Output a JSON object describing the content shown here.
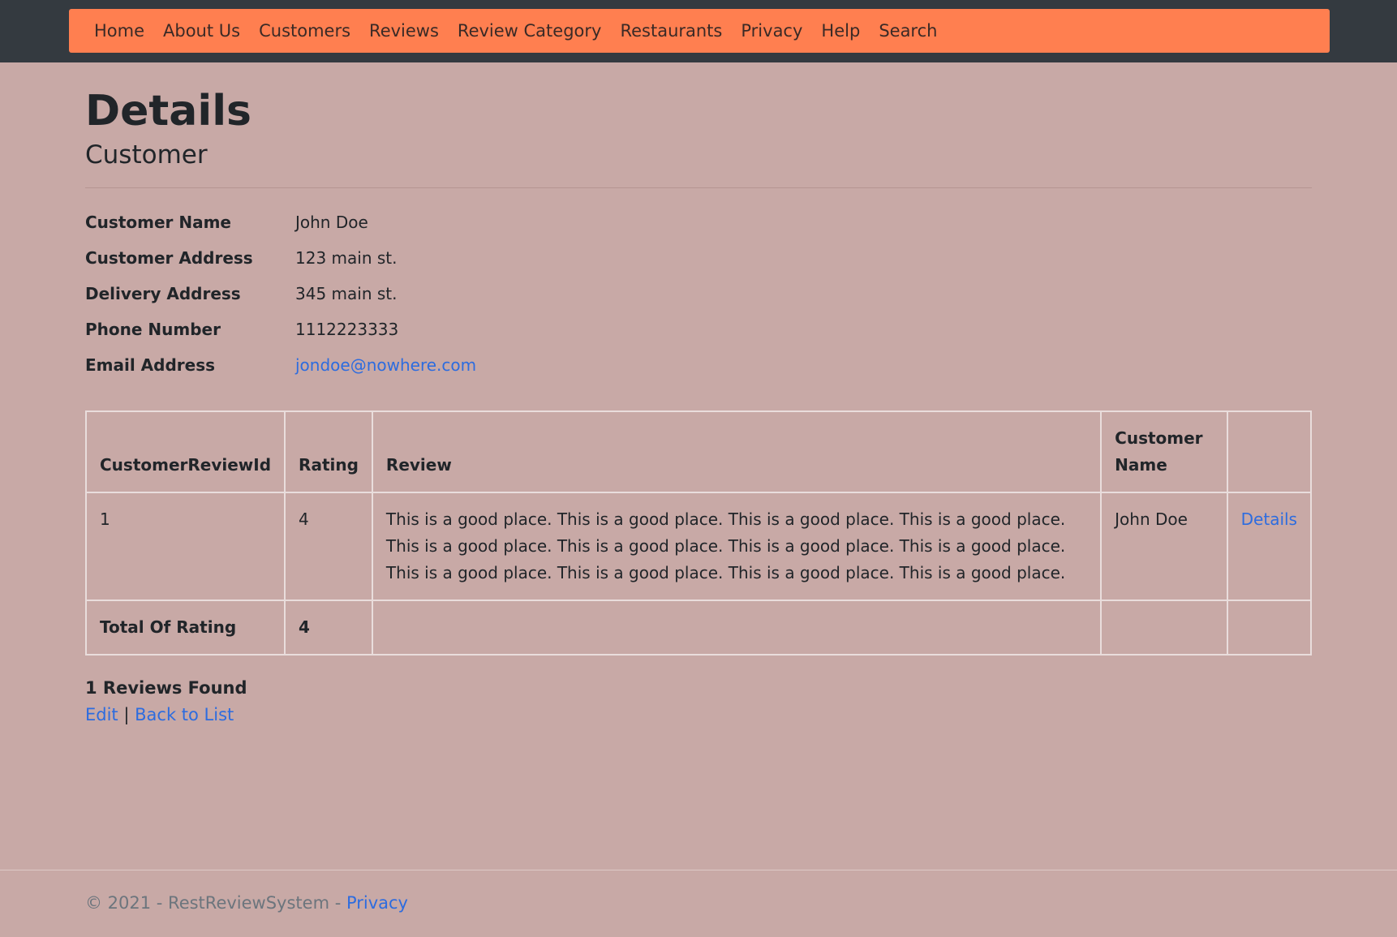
{
  "nav": {
    "items": [
      "Home",
      "About Us",
      "Customers",
      "Reviews",
      "Review Category",
      "Restaurants",
      "Privacy",
      "Help",
      "Search"
    ]
  },
  "page": {
    "title": "Details",
    "subtitle": "Customer"
  },
  "details": {
    "name_label": "Customer Name",
    "name_value": "John Doe",
    "address_label": "Customer Address",
    "address_value": "123 main st.",
    "delivery_label": "Delivery Address",
    "delivery_value": "345 main st.",
    "phone_label": "Phone Number",
    "phone_value": "1112223333",
    "email_label": "Email Address",
    "email_value": "jondoe@nowhere.com"
  },
  "table": {
    "headers": [
      "CustomerReviewId",
      "Rating",
      "Review",
      "Customer Name",
      ""
    ],
    "rows": [
      {
        "id": "1",
        "rating": "4",
        "review": "This is a good place. This is a good place. This is a good place. This is a good place. This is a good place. This is a good place. This is a good place. This is a good place. This is a good place. This is a good place. This is a good place. This is a good place.",
        "customer_name": "John Doe",
        "action": "Details"
      }
    ],
    "total_label": "Total Of Rating",
    "total_value": "4"
  },
  "summary": {
    "found": "1 Reviews Found",
    "edit": "Edit",
    "separator": "|",
    "back": "Back to List"
  },
  "footer": {
    "text": "© 2021 - RestReviewSystem - ",
    "privacy": "Privacy"
  }
}
